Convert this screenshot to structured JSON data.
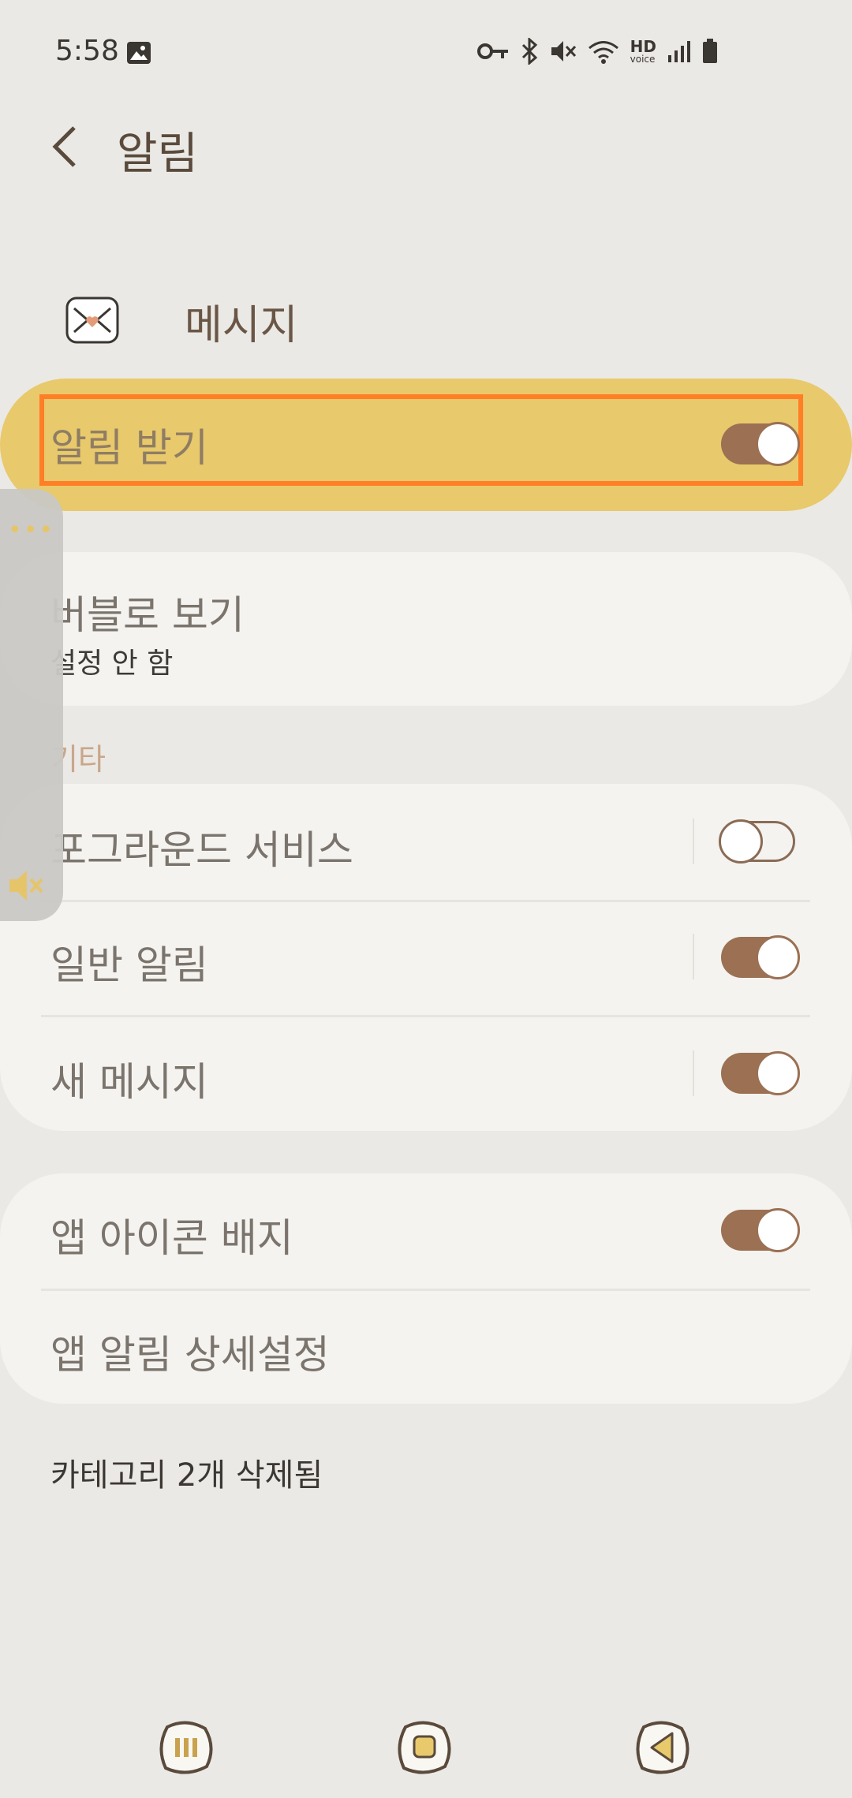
{
  "status_bar": {
    "time": "5:58",
    "icons": [
      "image-icon",
      "key-icon",
      "bluetooth-icon",
      "mute-icon",
      "wifi-icon",
      "hd-voice-icon",
      "signal-icon",
      "battery-icon"
    ],
    "hd_label": "HD",
    "voice_label": "voice"
  },
  "header": {
    "title": "알림",
    "back_icon": "chevron-left-icon"
  },
  "app": {
    "name": "메시지",
    "icon": "envelope-heart-icon"
  },
  "master": {
    "label": "알림 받기",
    "enabled": true
  },
  "bubble": {
    "title": "버블로 보기",
    "subtitle": "설정 안 함"
  },
  "other_section": {
    "label": "기타",
    "items": [
      {
        "label": "포그라운드 서비스",
        "enabled": false
      },
      {
        "label": "일반 알림",
        "enabled": true
      },
      {
        "label": "새 메시지",
        "enabled": true
      }
    ]
  },
  "app_settings": {
    "items": [
      {
        "label": "앱 아이콘 배지",
        "enabled": true
      },
      {
        "label": "앱 알림 상세설정"
      }
    ]
  },
  "footer": {
    "text": "카테고리 2개 삭제됨"
  },
  "side_panel": {
    "dots": "•••",
    "icon": "mute-icon"
  },
  "nav": {
    "recent": "recent-apps-icon",
    "home": "home-icon",
    "back": "back-icon"
  },
  "colors": {
    "accent": "#e8c96c",
    "toggle": "#9b7053",
    "highlight_border": "#ff7e26"
  }
}
